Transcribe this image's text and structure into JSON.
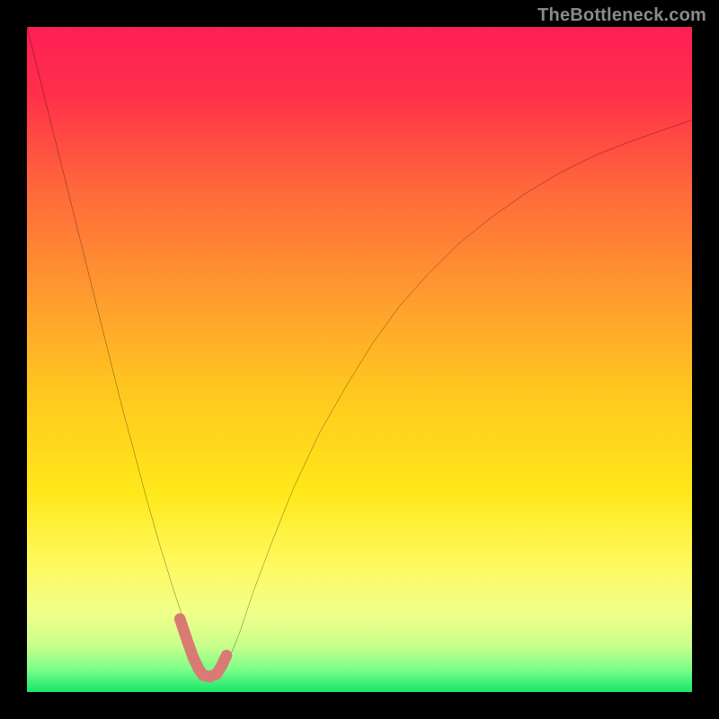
{
  "watermark": "TheBottleneck.com",
  "chart_data": {
    "type": "line",
    "title": "",
    "xlabel": "",
    "ylabel": "",
    "xlim": [
      0,
      100
    ],
    "ylim": [
      0,
      100
    ],
    "grid": false,
    "legend": false,
    "gradient_stops": [
      {
        "offset": 0.0,
        "color": "#ff1e55"
      },
      {
        "offset": 0.1,
        "color": "#ff2f4a"
      },
      {
        "offset": 0.25,
        "color": "#ff6a3a"
      },
      {
        "offset": 0.4,
        "color": "#ff9a2f"
      },
      {
        "offset": 0.55,
        "color": "#ffc81f"
      },
      {
        "offset": 0.7,
        "color": "#ffe81a"
      },
      {
        "offset": 0.8,
        "color": "#fff85a"
      },
      {
        "offset": 0.88,
        "color": "#f2ff8a"
      },
      {
        "offset": 0.93,
        "color": "#c8ff8a"
      },
      {
        "offset": 0.965,
        "color": "#7dff8a"
      },
      {
        "offset": 1.0,
        "color": "#17e66b"
      }
    ],
    "series": [
      {
        "name": "bottleneck-curve",
        "stroke": "#000000",
        "x": [
          0.0,
          2.0,
          4.0,
          6.0,
          8.0,
          10.0,
          12.0,
          14.0,
          16.0,
          18.0,
          20.0,
          22.0,
          24.0,
          25.5,
          27.0,
          28.5,
          30.0,
          32.0,
          34.0,
          37.0,
          40.0,
          44.0,
          48.0,
          52.0,
          56.0,
          60.0,
          65.0,
          70.0,
          75.0,
          80.0,
          85.0,
          90.0,
          95.0,
          100.0
        ],
        "y": [
          100.0,
          92.0,
          84.0,
          76.0,
          68.0,
          60.0,
          52.0,
          44.0,
          36.5,
          29.0,
          22.0,
          15.5,
          9.5,
          5.0,
          2.3,
          2.0,
          4.0,
          9.0,
          15.0,
          23.0,
          30.5,
          39.0,
          46.0,
          52.5,
          58.0,
          62.5,
          67.5,
          71.5,
          75.0,
          78.0,
          80.5,
          82.5,
          84.3,
          86.0
        ]
      },
      {
        "name": "valley-highlight",
        "stroke": "#d97a74",
        "x": [
          23.0,
          24.0,
          25.0,
          25.8,
          26.5,
          27.5,
          28.5,
          29.3,
          30.0
        ],
        "y": [
          11.0,
          8.0,
          5.2,
          3.5,
          2.5,
          2.3,
          2.7,
          4.0,
          5.5
        ]
      }
    ]
  }
}
